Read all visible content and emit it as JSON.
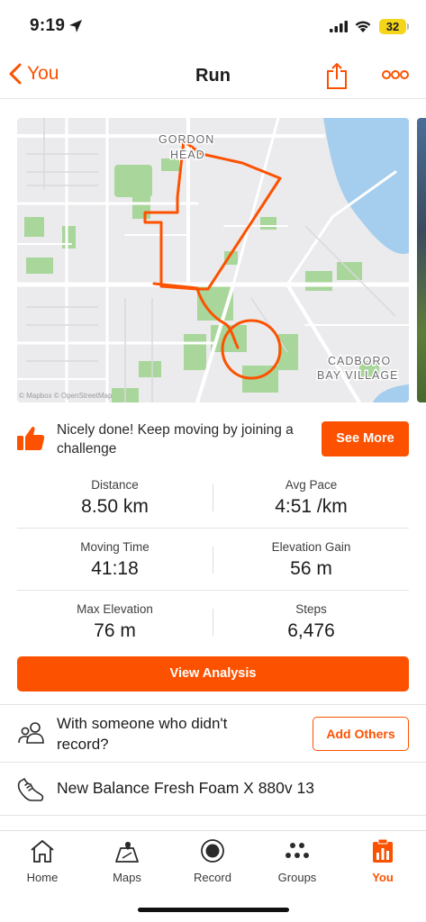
{
  "status_bar": {
    "time": "9:19",
    "battery": "32"
  },
  "nav": {
    "back_label": "You",
    "title": "Run"
  },
  "map": {
    "place_labels": [
      "GORDON",
      "HEAD",
      "CADBORO",
      "BAY VILLAGE"
    ],
    "attribution": "© Mapbox © OpenStreetMap",
    "route_color": "#fc5200"
  },
  "challenge": {
    "text": "Nicely done! Keep moving by joining a challenge",
    "button": "See More"
  },
  "stats": [
    {
      "left": {
        "label": "Distance",
        "value": "8.50 km"
      },
      "right": {
        "label": "Avg Pace",
        "value": "4:51 /km"
      }
    },
    {
      "left": {
        "label": "Moving Time",
        "value": "41:18"
      },
      "right": {
        "label": "Elevation Gain",
        "value": "56 m"
      }
    },
    {
      "left": {
        "label": "Max Elevation",
        "value": "76 m"
      },
      "right": {
        "label": "Steps",
        "value": "6,476"
      }
    }
  ],
  "analysis_button": "View Analysis",
  "others": {
    "text": "With someone who didn't record?",
    "button": "Add Others"
  },
  "gear": {
    "name": "New Balance Fresh Foam X 880v 13"
  },
  "tabs": [
    {
      "label": "Home",
      "icon": "home-icon"
    },
    {
      "label": "Maps",
      "icon": "maps-icon"
    },
    {
      "label": "Record",
      "icon": "record-icon"
    },
    {
      "label": "Groups",
      "icon": "groups-icon"
    },
    {
      "label": "You",
      "icon": "you-icon",
      "active": true
    }
  ],
  "colors": {
    "accent": "#fc5200",
    "battery": "#f5d51a"
  }
}
